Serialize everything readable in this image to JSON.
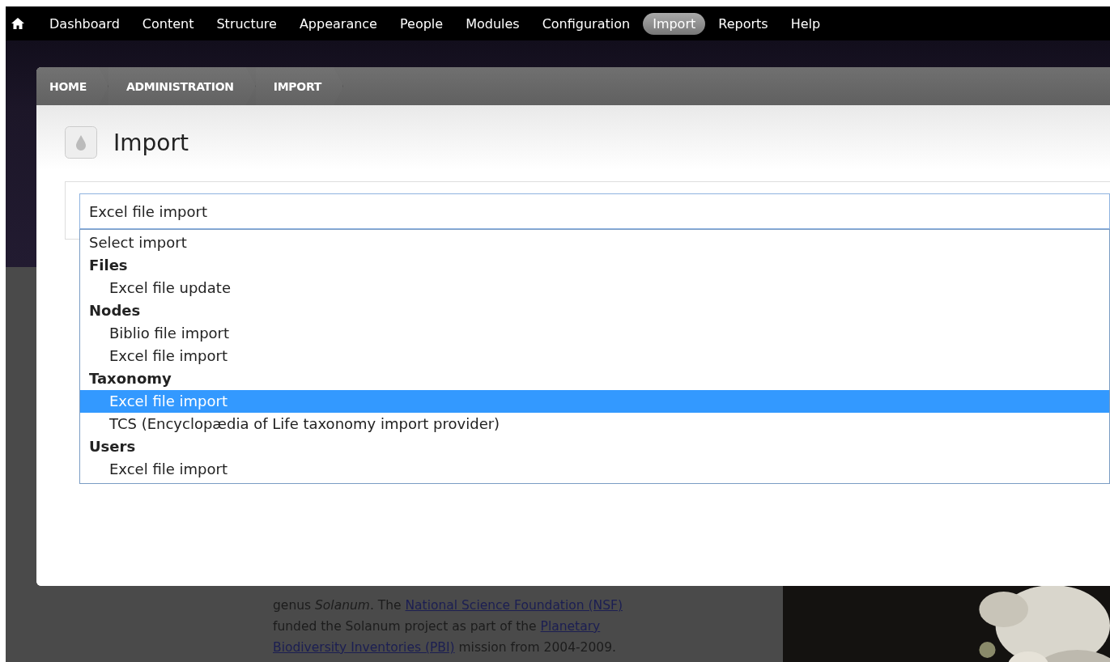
{
  "nav": {
    "items": [
      {
        "label": "Dashboard",
        "selected": false
      },
      {
        "label": "Content",
        "selected": false
      },
      {
        "label": "Structure",
        "selected": false
      },
      {
        "label": "Appearance",
        "selected": false
      },
      {
        "label": "People",
        "selected": false
      },
      {
        "label": "Modules",
        "selected": false
      },
      {
        "label": "Configuration",
        "selected": false
      },
      {
        "label": "Import",
        "selected": true
      },
      {
        "label": "Reports",
        "selected": false
      },
      {
        "label": "Help",
        "selected": false
      }
    ]
  },
  "dialog": {
    "breadcrumb": [
      "HOME",
      "ADMINISTRATION",
      "IMPORT"
    ],
    "title": "Import",
    "select": {
      "value": "Excel file import",
      "options": [
        {
          "kind": "option",
          "label": "Select import",
          "selected": false
        },
        {
          "kind": "group",
          "label": "Files",
          "children": [
            {
              "kind": "option",
              "label": "Excel file update",
              "selected": false
            }
          ]
        },
        {
          "kind": "group",
          "label": "Nodes",
          "children": [
            {
              "kind": "option",
              "label": "Biblio file import",
              "selected": false
            },
            {
              "kind": "option",
              "label": "Excel file import",
              "selected": false
            }
          ]
        },
        {
          "kind": "group",
          "label": "Taxonomy",
          "children": [
            {
              "kind": "option",
              "label": "Excel file import",
              "selected": true
            },
            {
              "kind": "option",
              "label": "TCS (Encyclopædia of Life taxonomy import provider)",
              "selected": false
            }
          ]
        },
        {
          "kind": "group",
          "label": "Users",
          "children": [
            {
              "kind": "option",
              "label": "Excel file import",
              "selected": false
            }
          ]
        }
      ]
    }
  },
  "background": {
    "paragraph_lines": [
      [
        {
          "kind": "text",
          "text": "genus *Solanum*. The "
        },
        {
          "kind": "link",
          "text": "National Science Foundation (NSF)"
        }
      ],
      [
        {
          "kind": "text",
          "text": "funded the Solanum project as part of the "
        },
        {
          "kind": "link",
          "text": "Planetary"
        }
      ],
      [
        {
          "kind": "link",
          "text": "Biodiversity Inventories (PBI)"
        },
        {
          "kind": "text",
          "text": " mission from 2004-2009."
        }
      ]
    ],
    "image": {
      "kind": "picture"
    }
  }
}
